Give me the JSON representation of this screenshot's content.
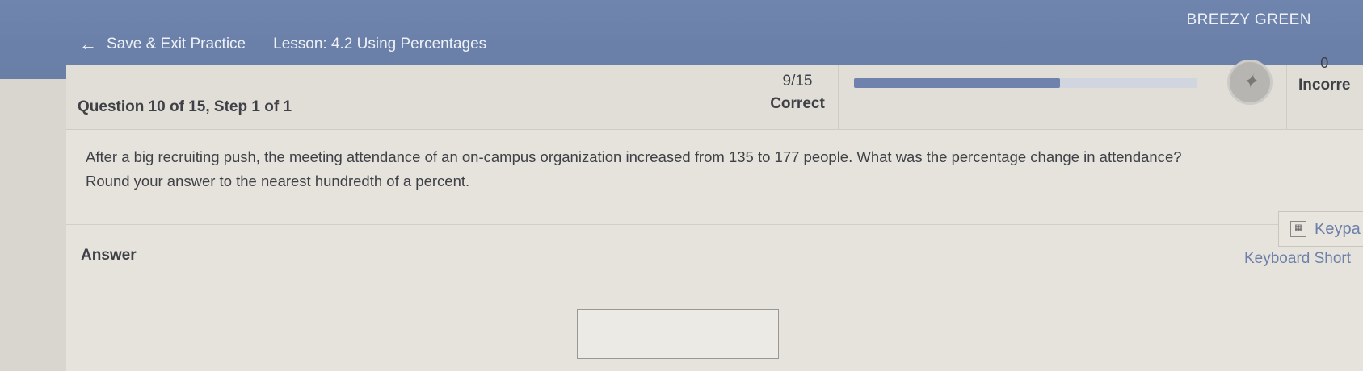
{
  "topbar": {
    "back_label": "Save & Exit Practice",
    "lesson": "Lesson: 4.2 Using Percentages",
    "user": "BREEZY GREEN"
  },
  "header": {
    "question_num": "Question 10 of 15,  Step 1 of 1",
    "correct_count": "9/15",
    "correct_label": "Correct",
    "progress_fraction": 0.6,
    "incorrect_count": "0",
    "incorrect_label": "Incorre"
  },
  "question": {
    "line1": "After a big recruiting push, the meeting attendance of an on-campus organization increased from 135 to 177 people. What was the percentage change in attendance?",
    "line2": "Round your answer to the nearest hundredth of a percent."
  },
  "answer": {
    "label": "Answer",
    "keypad_label": "Keypa",
    "shortcuts_label": "Keyboard Short"
  },
  "colors": {
    "topbar": "#6f85ad",
    "accent": "#6c7fa8"
  },
  "icons": {
    "back": "back-arrow-icon",
    "badge": "streak-badge-icon",
    "keypad": "calculator-icon"
  }
}
